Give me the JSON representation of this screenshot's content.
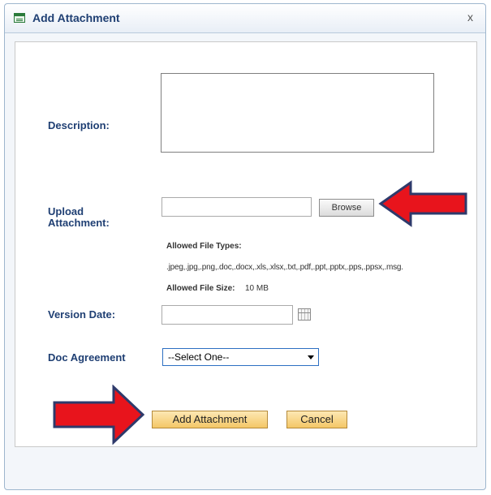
{
  "dialog": {
    "title": "Add Attachment",
    "close_glyph": "x"
  },
  "form": {
    "description_label": "Description:",
    "upload_label_line1": "Upload",
    "upload_label_line2": "Attachment:",
    "browse_label": "Browse",
    "allowed_types_label": "Allowed File Types:",
    "allowed_types_value": ".jpeg,.jpg,.png,.doc,.docx,.xls,.xlsx,.txt,.pdf,.ppt,.pptx,.pps,.ppsx,.msg.",
    "allowed_size_label": "Allowed File Size:",
    "allowed_size_value": "10 MB",
    "version_date_label": "Version Date:",
    "doc_agreement_label": "Doc Agreement",
    "doc_agreement_selected": "--Select One--"
  },
  "actions": {
    "add_attachment_label": "Add Attachment",
    "cancel_label": "Cancel"
  },
  "colors": {
    "label_blue": "#1f3f73",
    "arrow_red": "#e8141c",
    "arrow_outline": "#2e3a6b",
    "button_orange": "#f4c766"
  },
  "icons": {
    "title": "attachment-dialog-icon",
    "close": "close-icon",
    "calendar": "calendar-icon",
    "dropdown": "chevron-down-icon"
  }
}
